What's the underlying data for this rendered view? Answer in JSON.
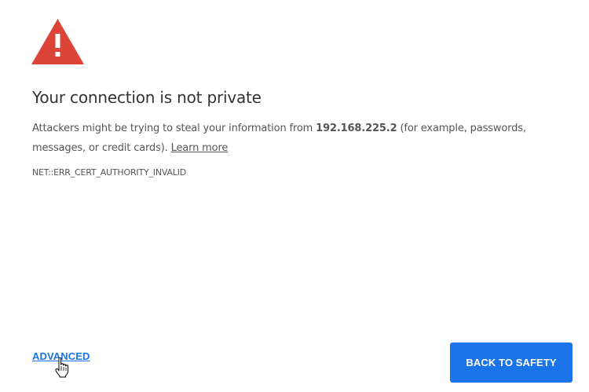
{
  "warning": {
    "icon": "warning-triangle-icon",
    "color": "#db4437"
  },
  "title": "Your connection is not private",
  "message": {
    "prefix": "Attackers might be trying to steal your information from ",
    "host": "192.168.225.2",
    "suffix": " (for example, passwords, messages, or credit cards). ",
    "learn_more": "Learn more"
  },
  "error_code": "NET::ERR_CERT_AUTHORITY_INVALID",
  "actions": {
    "advanced_label": "ADVANCED",
    "back_label": "BACK TO SAFETY",
    "primary_color": "#1a73e8"
  },
  "pointer": {
    "icon": "hand-pointer-cursor-icon"
  }
}
